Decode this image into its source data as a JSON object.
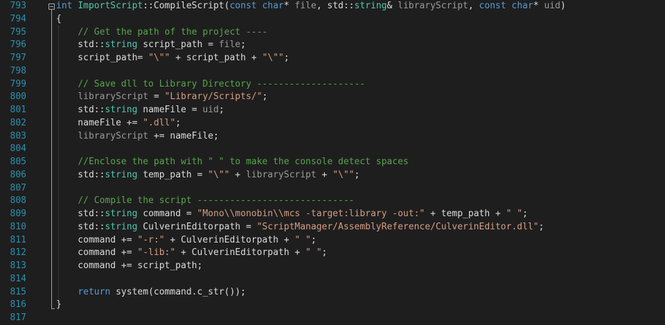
{
  "editor": {
    "lines": [
      {
        "n": "793",
        "tokens": [
          [
            "kw",
            "int"
          ],
          [
            "pl",
            " "
          ],
          [
            "ty",
            "ImportScript"
          ],
          [
            "pl",
            "::"
          ],
          [
            "pl",
            "CompileScript("
          ],
          [
            "kw",
            "const"
          ],
          [
            "pl",
            " "
          ],
          [
            "kw",
            "char"
          ],
          [
            "pl",
            "* "
          ],
          [
            "pm",
            "file"
          ],
          [
            "pl",
            ", std::"
          ],
          [
            "ty",
            "string"
          ],
          [
            "pl",
            "& "
          ],
          [
            "pm",
            "libraryScript"
          ],
          [
            "pl",
            ", "
          ],
          [
            "kw",
            "const"
          ],
          [
            "pl",
            " "
          ],
          [
            "kw",
            "char"
          ],
          [
            "pl",
            "* "
          ],
          [
            "pm",
            "uid"
          ],
          [
            "pl",
            ")"
          ]
        ]
      },
      {
        "n": "794",
        "tokens": [
          [
            "pl",
            "{"
          ]
        ]
      },
      {
        "n": "795",
        "tokens": [
          [
            "pl",
            "    "
          ],
          [
            "cm",
            "// Get the path of the project ----"
          ]
        ]
      },
      {
        "n": "796",
        "tokens": [
          [
            "pl",
            "    std::"
          ],
          [
            "ty",
            "string"
          ],
          [
            "pl",
            " script_path = "
          ],
          [
            "pm",
            "file"
          ],
          [
            "pl",
            ";"
          ]
        ]
      },
      {
        "n": "797",
        "tokens": [
          [
            "pl",
            "    script_path= "
          ],
          [
            "st",
            "\"\\\"\""
          ],
          [
            "pl",
            " + script_path + "
          ],
          [
            "st",
            "\"\\\"\""
          ],
          [
            "pl",
            ";"
          ]
        ]
      },
      {
        "n": "798",
        "tokens": []
      },
      {
        "n": "799",
        "tokens": [
          [
            "pl",
            "    "
          ],
          [
            "cm",
            "// Save dll to Library Directory --------------------"
          ]
        ]
      },
      {
        "n": "800",
        "tokens": [
          [
            "pl",
            "    "
          ],
          [
            "pm",
            "libraryScript"
          ],
          [
            "pl",
            " = "
          ],
          [
            "st",
            "\"Library/Scripts/\""
          ],
          [
            "pl",
            ";"
          ]
        ]
      },
      {
        "n": "801",
        "tokens": [
          [
            "pl",
            "    std::"
          ],
          [
            "ty",
            "string"
          ],
          [
            "pl",
            " nameFile = "
          ],
          [
            "pm",
            "uid"
          ],
          [
            "pl",
            ";"
          ]
        ]
      },
      {
        "n": "802",
        "tokens": [
          [
            "pl",
            "    nameFile += "
          ],
          [
            "st",
            "\".dll\""
          ],
          [
            "pl",
            ";"
          ]
        ]
      },
      {
        "n": "803",
        "tokens": [
          [
            "pl",
            "    "
          ],
          [
            "pm",
            "libraryScript"
          ],
          [
            "pl",
            " += nameFile;"
          ]
        ]
      },
      {
        "n": "804",
        "tokens": []
      },
      {
        "n": "805",
        "tokens": [
          [
            "pl",
            "    "
          ],
          [
            "cm",
            "//Enclose the path with \" \" to make the console detect spaces"
          ]
        ]
      },
      {
        "n": "806",
        "tokens": [
          [
            "pl",
            "    std::"
          ],
          [
            "ty",
            "string"
          ],
          [
            "pl",
            " temp_path = "
          ],
          [
            "st",
            "\"\\\"\""
          ],
          [
            "pl",
            " + "
          ],
          [
            "pm",
            "libraryScript"
          ],
          [
            "pl",
            " + "
          ],
          [
            "st",
            "\"\\\"\""
          ],
          [
            "pl",
            ";"
          ]
        ]
      },
      {
        "n": "807",
        "tokens": []
      },
      {
        "n": "808",
        "tokens": [
          [
            "pl",
            "    "
          ],
          [
            "cm",
            "// Compile the script -----------------------------"
          ]
        ]
      },
      {
        "n": "809",
        "tokens": [
          [
            "pl",
            "    std::"
          ],
          [
            "ty",
            "string"
          ],
          [
            "pl",
            " command = "
          ],
          [
            "st",
            "\"Mono\\\\monobin\\\\mcs -target:library -out:\""
          ],
          [
            "pl",
            " + temp_path + "
          ],
          [
            "st",
            "\" \""
          ],
          [
            "pl",
            ";"
          ]
        ]
      },
      {
        "n": "810",
        "tokens": [
          [
            "pl",
            "    std::"
          ],
          [
            "ty",
            "string"
          ],
          [
            "pl",
            " CulverinEditorpath = "
          ],
          [
            "st",
            "\"ScriptManager/AssemblyReference/CulverinEditor.dll\""
          ],
          [
            "pl",
            ";"
          ]
        ]
      },
      {
        "n": "811",
        "tokens": [
          [
            "pl",
            "    command += "
          ],
          [
            "st",
            "\"-r:\""
          ],
          [
            "pl",
            " + CulverinEditorpath + "
          ],
          [
            "st",
            "\" \""
          ],
          [
            "pl",
            ";"
          ]
        ]
      },
      {
        "n": "812",
        "tokens": [
          [
            "pl",
            "    command += "
          ],
          [
            "st",
            "\"-lib:\""
          ],
          [
            "pl",
            " + CulverinEditorpath + "
          ],
          [
            "st",
            "\" \""
          ],
          [
            "pl",
            ";"
          ]
        ]
      },
      {
        "n": "813",
        "tokens": [
          [
            "pl",
            "    command += script_path;"
          ]
        ]
      },
      {
        "n": "814",
        "tokens": []
      },
      {
        "n": "815",
        "tokens": [
          [
            "pl",
            "    "
          ],
          [
            "kw",
            "return"
          ],
          [
            "pl",
            " system(command.c_str());"
          ]
        ]
      },
      {
        "n": "816",
        "tokens": [
          [
            "pl",
            "}"
          ]
        ]
      },
      {
        "n": "817",
        "tokens": []
      }
    ]
  }
}
